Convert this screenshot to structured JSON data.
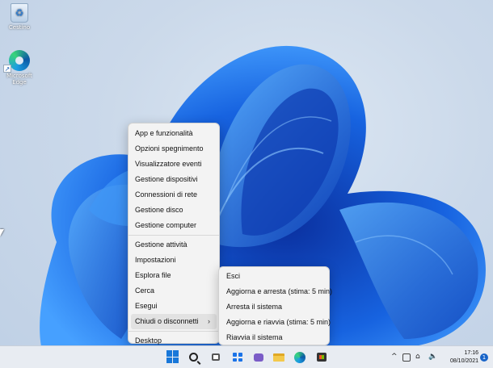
{
  "desktop_icons": [
    {
      "label": "Cestino",
      "icon": "recycle-bin-icon"
    },
    {
      "label": "Microsoft Edge",
      "icon": "edge-icon"
    }
  ],
  "winx_menu": {
    "items": [
      "App e funzionalità",
      "Opzioni spegnimento",
      "Visualizzatore eventi",
      "Gestione dispositivi",
      "Connessioni di rete",
      "Gestione disco",
      "Gestione computer",
      "Gestione attività",
      "Impostazioni",
      "Esplora file",
      "Cerca",
      "Esegui",
      "Chiudi o disconnetti",
      "Desktop"
    ],
    "submenu_arrow": "›"
  },
  "shutdown_submenu": {
    "items": [
      "Esci",
      "Aggiorna e arresta (stima: 5 min)",
      "Arresta il sistema",
      "Aggiorna e riavvia (stima: 5 min)",
      "Riavvia il sistema"
    ]
  },
  "taskbar": {
    "time": "17:16",
    "date": "08/10/2021",
    "notification_count": "1",
    "tray_chevron": "^"
  },
  "colors": {
    "wallpaper_bloom": "#1565d8",
    "accent": "#1877d9",
    "menu_bg": "#f3f3f3"
  }
}
